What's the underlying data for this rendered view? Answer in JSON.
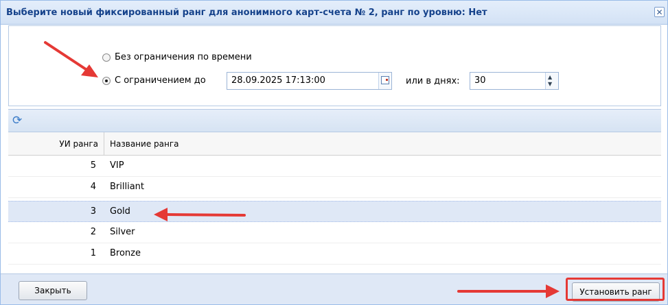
{
  "dialog": {
    "title": "Выберите новый фиксированный ранг для анонимного карт-счета № 2, ранг по уровню: Нет",
    "close_glyph": "✕"
  },
  "time_options": {
    "unlimited_label": "Без ограничения по времени",
    "unlimited_selected": false,
    "limited_label": "С ограничением до",
    "limited_selected": true,
    "date_value": "28.09.2025 17:13:00",
    "days_label": "или в днях:",
    "days_value": "30"
  },
  "toolbar": {
    "refresh_icon": "refresh-icon"
  },
  "grid": {
    "columns": [
      "УИ ранга",
      "Название ранга"
    ],
    "rows": [
      {
        "id": "5",
        "name": "VIP",
        "selected": false
      },
      {
        "id": "4",
        "name": "Brilliant",
        "selected": false
      },
      {
        "id": "3",
        "name": "Gold",
        "selected": true
      },
      {
        "id": "2",
        "name": "Silver",
        "selected": false
      },
      {
        "id": "1",
        "name": "Bronze",
        "selected": false
      }
    ]
  },
  "footer": {
    "close_label": "Закрыть",
    "set_rank_label": "Установить ранг"
  },
  "colors": {
    "title_text": "#15428b",
    "annotation_red": "#e53935",
    "selection_bg": "#dfe8f6"
  }
}
